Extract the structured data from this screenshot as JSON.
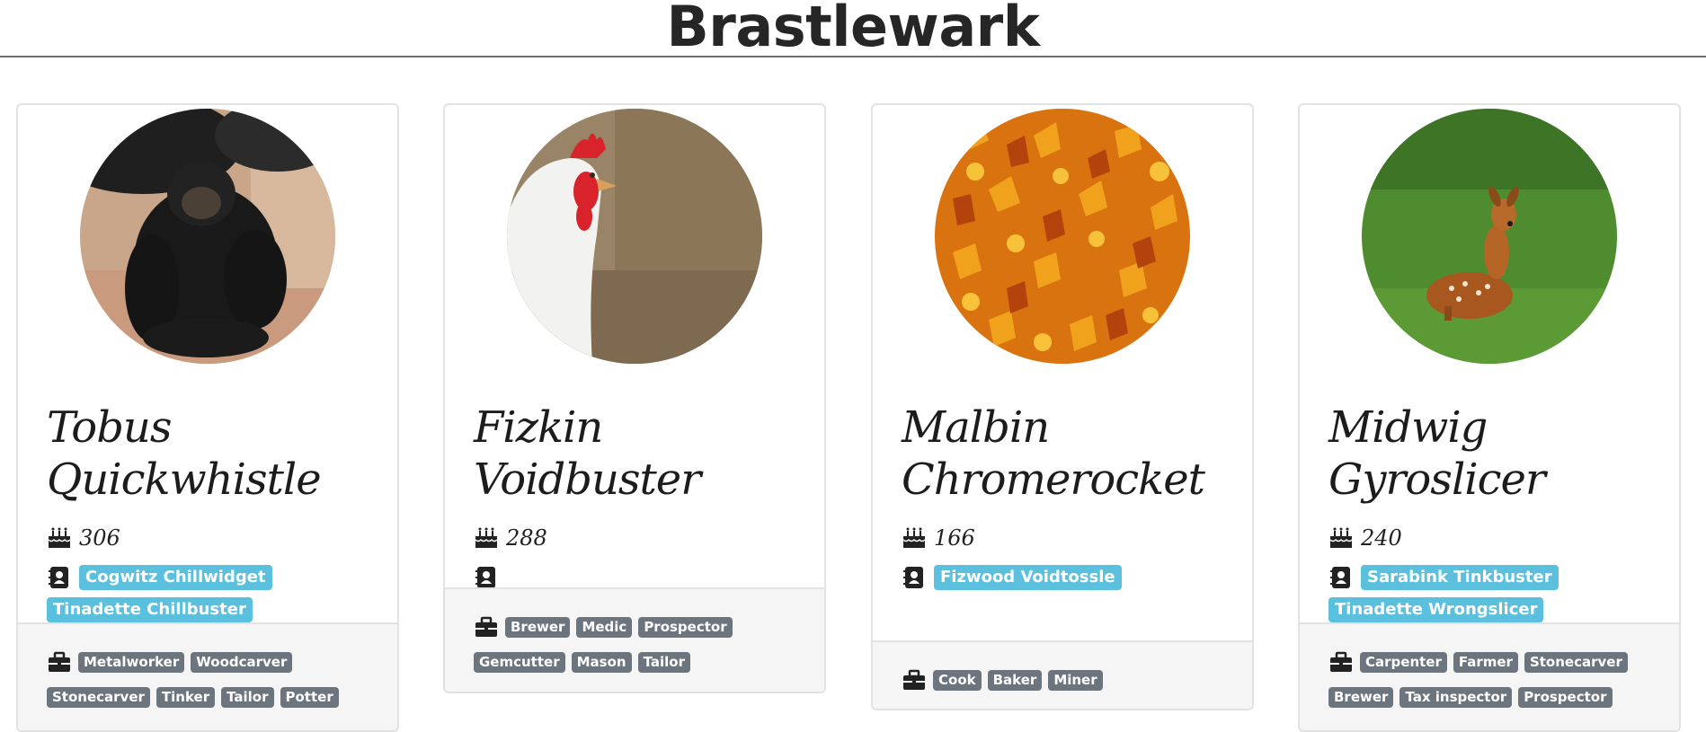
{
  "header": {
    "title": "Brastlewark"
  },
  "cards": [
    {
      "name": "Tobus Quickwhistle",
      "age": "306",
      "image": "chimpanzee",
      "friends": [
        "Cogwitz Chillwidget",
        "Tinadette Chillbuster"
      ],
      "professions": [
        "Metalworker",
        "Woodcarver",
        "Stonecarver",
        "Tinker",
        "Tailor",
        "Potter"
      ]
    },
    {
      "name": "Fizkin Voidbuster",
      "age": "288",
      "image": "chicken",
      "friends": [],
      "professions": [
        "Brewer",
        "Medic",
        "Prospector",
        "Gemcutter",
        "Mason",
        "Tailor"
      ]
    },
    {
      "name": "Malbin Chromerocket",
      "age": "166",
      "image": "autumn-leaves",
      "friends": [
        "Fizwood Voidtossle"
      ],
      "professions": [
        "Cook",
        "Baker",
        "Miner"
      ]
    },
    {
      "name": "Midwig Gyroslicer",
      "age": "240",
      "image": "fawn",
      "friends": [
        "Sarabink Tinkbuster",
        "Tinadette Wrongslicer"
      ],
      "professions": [
        "Carpenter",
        "Farmer",
        "Stonecarver",
        "Brewer",
        "Tax inspector",
        "Prospector"
      ]
    }
  ],
  "icons": {
    "age": "birthday-cake-icon",
    "friends": "address-book-icon",
    "professions": "briefcase-icon"
  },
  "colors": {
    "friend_badge": "#5bc0de",
    "profession_badge": "#6c757d",
    "footer_bg": "#f5f5f6"
  }
}
